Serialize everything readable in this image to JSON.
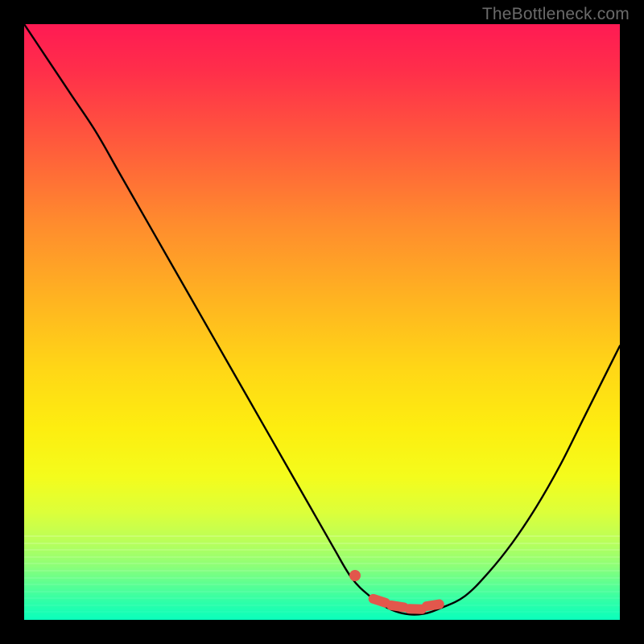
{
  "watermark": "TheBottleneck.com",
  "colors": {
    "curve": "#000000",
    "highlight": "#e2574c",
    "frame": "#000000"
  },
  "chart_data": {
    "type": "line",
    "title": "",
    "xlabel": "",
    "ylabel": "",
    "xlim": [
      0,
      100
    ],
    "ylim": [
      0,
      100
    ],
    "grid": false,
    "legend": false,
    "series": [
      {
        "name": "bottleneck-curve",
        "x": [
          0,
          4,
          8,
          12,
          16,
          20,
          24,
          28,
          32,
          36,
          40,
          44,
          48,
          52,
          55,
          58,
          61,
          64,
          67,
          70,
          74,
          78,
          82,
          86,
          90,
          94,
          98,
          100
        ],
        "y": [
          100,
          94,
          88,
          82,
          75,
          68,
          61,
          54,
          47,
          40,
          33,
          26,
          19,
          12,
          7,
          4,
          2,
          1,
          1,
          2,
          4,
          8,
          13,
          19,
          26,
          34,
          42,
          46
        ]
      }
    ],
    "highlight_range": {
      "x_start": 55,
      "x_end": 70,
      "color": "#e2574c",
      "comment": "optimal / no-bottleneck region along the valley floor"
    },
    "marker": {
      "x": 55,
      "y": 7,
      "color": "#e2574c"
    },
    "background_gradient": {
      "orientation": "vertical",
      "stops": [
        {
          "pos": 0.0,
          "color": "#ff1a53"
        },
        {
          "pos": 0.5,
          "color": "#ffd716"
        },
        {
          "pos": 0.8,
          "color": "#dcff3a"
        },
        {
          "pos": 1.0,
          "color": "#0affbc"
        }
      ]
    }
  }
}
